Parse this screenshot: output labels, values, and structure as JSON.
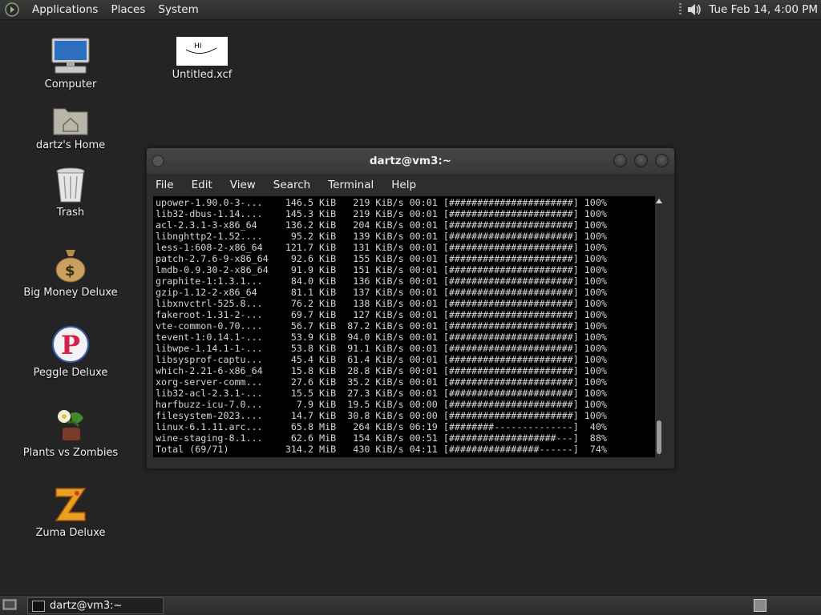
{
  "top_panel": {
    "menus": [
      "Applications",
      "Places",
      "System"
    ],
    "clock": "Tue Feb 14,  4:00 PM"
  },
  "desktop_icons": [
    {
      "label": "Computer",
      "icon": "computer-icon"
    },
    {
      "label": "Untitled.xcf",
      "icon": "image-file-icon",
      "thumb_text": "HI"
    },
    {
      "label": "dartz's Home",
      "icon": "home-folder-icon"
    },
    {
      "label": "Trash",
      "icon": "trash-icon"
    },
    {
      "label": "Big Money Deluxe",
      "icon": "money-bag-icon"
    },
    {
      "label": "Peggle Deluxe",
      "icon": "peggle-icon"
    },
    {
      "label": "Plants vs Zombies",
      "icon": "plants-vs-zombies-icon"
    },
    {
      "label": "Zuma Deluxe",
      "icon": "zuma-icon"
    }
  ],
  "terminal": {
    "title": "dartz@vm3:~",
    "menu": [
      "File",
      "Edit",
      "View",
      "Search",
      "Terminal",
      "Help"
    ],
    "lines": [
      "upower-1.90.0-3-...    146.5 KiB   219 KiB/s 00:01 [######################] 100%",
      "lib32-dbus-1.14....    145.3 KiB   219 KiB/s 00:01 [######################] 100%",
      "acl-2.3.1-3-x86_64     136.2 KiB   204 KiB/s 00:01 [######################] 100%",
      "libnghttp2-1.52....     95.2 KiB   139 KiB/s 00:01 [######################] 100%",
      "less-1:608-2-x86_64    121.7 KiB   131 KiB/s 00:01 [######################] 100%",
      "patch-2.7.6-9-x86_64    92.6 KiB   155 KiB/s 00:01 [######################] 100%",
      "lmdb-0.9.30-2-x86_64    91.9 KiB   151 KiB/s 00:01 [######################] 100%",
      "graphite-1:1.3.1...     84.0 KiB   136 KiB/s 00:01 [######################] 100%",
      "gzip-1.12-2-x86_64      81.1 KiB   137 KiB/s 00:01 [######################] 100%",
      "libxnvctrl-525.8...     76.2 KiB   138 KiB/s 00:01 [######################] 100%",
      "fakeroot-1.31-2-...     69.7 KiB   127 KiB/s 00:01 [######################] 100%",
      "vte-common-0.70....     56.7 KiB  87.2 KiB/s 00:01 [######################] 100%",
      "tevent-1:0.14.1-...     53.9 KiB  94.0 KiB/s 00:01 [######################] 100%",
      "libwpe-1.14.1-1-...     53.8 KiB  91.1 KiB/s 00:01 [######################] 100%",
      "libsysprof-captu...     45.4 KiB  61.4 KiB/s 00:01 [######################] 100%",
      "which-2.21-6-x86_64     15.8 KiB  28.8 KiB/s 00:01 [######################] 100%",
      "xorg-server-comm...     27.6 KiB  35.2 KiB/s 00:01 [######################] 100%",
      "lib32-acl-2.3.1-...     15.5 KiB  27.3 KiB/s 00:01 [######################] 100%",
      "harfbuzz-icu-7.0...      7.9 KiB  19.5 KiB/s 00:00 [######################] 100%",
      "filesystem-2023....     14.7 KiB  30.8 KiB/s 00:00 [######################] 100%",
      "linux-6.1.11.arc...     65.8 MiB   264 KiB/s 06:19 [########--------------]  40%",
      "wine-staging-8.1...     62.6 MiB   154 KiB/s 00:51 [###################---]  88%",
      "Total (69/71)          314.2 MiB   430 KiB/s 04:11 [################------]  74%"
    ]
  },
  "taskbar": {
    "task_label": "dartz@vm3:~"
  },
  "colors": {
    "desktop_bg": "#242424",
    "panel_bg": "#333333",
    "terminal_bg": "#000000",
    "terminal_fg": "#d6d6d6"
  }
}
